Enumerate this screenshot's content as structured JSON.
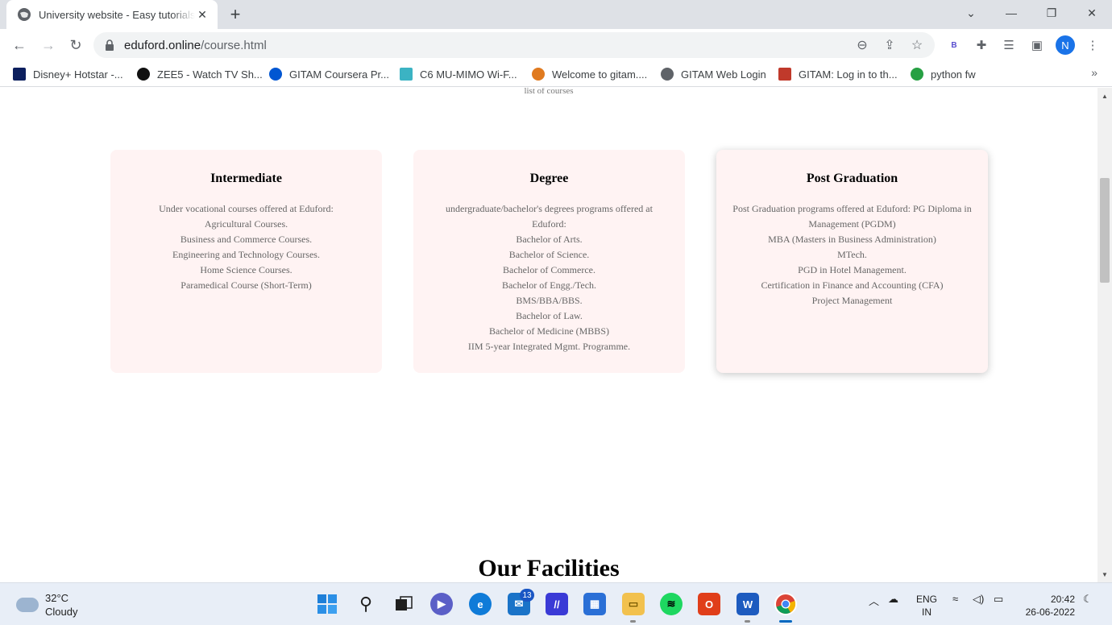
{
  "browser": {
    "tab_title": "University website - Easy tutorials",
    "url_host": "eduford.online",
    "url_path": "/course.html",
    "profile_initial": "N",
    "ext_label": "B"
  },
  "bookmarks": [
    {
      "label": "Disney+ Hotstar -...",
      "color": "#0c1f5e"
    },
    {
      "label": "ZEE5 - Watch TV Sh...",
      "color": "#111111"
    },
    {
      "label": "GITAM Coursera Pr...",
      "color": "#0056d2"
    },
    {
      "label": "C6 MU-MIMO Wi-F...",
      "color": "#3bb3c3"
    },
    {
      "label": "Welcome to gitam....",
      "color": "#e07a1f"
    },
    {
      "label": "GITAM Web Login",
      "color": "#5f6368"
    },
    {
      "label": "GITAM: Log in to th...",
      "color": "#c0392b"
    },
    {
      "label": "python fw",
      "color": "#27a043"
    }
  ],
  "page": {
    "subtitle": "list of courses",
    "cards": [
      {
        "title": "Intermediate",
        "lines": [
          "Under vocational courses offered at Eduford:",
          "Agricultural Courses.",
          "Business and Commerce Courses.",
          "Engineering and Technology Courses.",
          "Home Science Courses.",
          "Paramedical Course (Short-Term)"
        ]
      },
      {
        "title": "Degree",
        "lines": [
          "undergraduate/bachelor's degrees programs offered at Eduford:",
          "Bachelor of Arts.",
          "Bachelor of Science.",
          "Bachelor of Commerce.",
          "Bachelor of Engg./Tech.",
          "BMS/BBA/BBS.",
          "Bachelor of Law.",
          "Bachelor of Medicine (MBBS)",
          "IIM 5-year Integrated Mgmt. Programme."
        ]
      },
      {
        "title": "Post Graduation",
        "lines": [
          "Post Graduation programs offered at Eduford: PG Diploma in Management (PGDM)",
          "MBA (Masters in Business Administration)",
          "MTech.",
          "PGD in Hotel Management.",
          "Certification in Finance and Accounting (CFA)",
          "Project Management"
        ]
      }
    ],
    "facilities_heading": "Our Facilities"
  },
  "taskbar": {
    "temperature": "32°C",
    "condition": "Cloudy",
    "mail_badge": "13",
    "lang_line1": "ENG",
    "lang_line2": "IN",
    "time": "20:42",
    "date": "26-06-2022"
  }
}
